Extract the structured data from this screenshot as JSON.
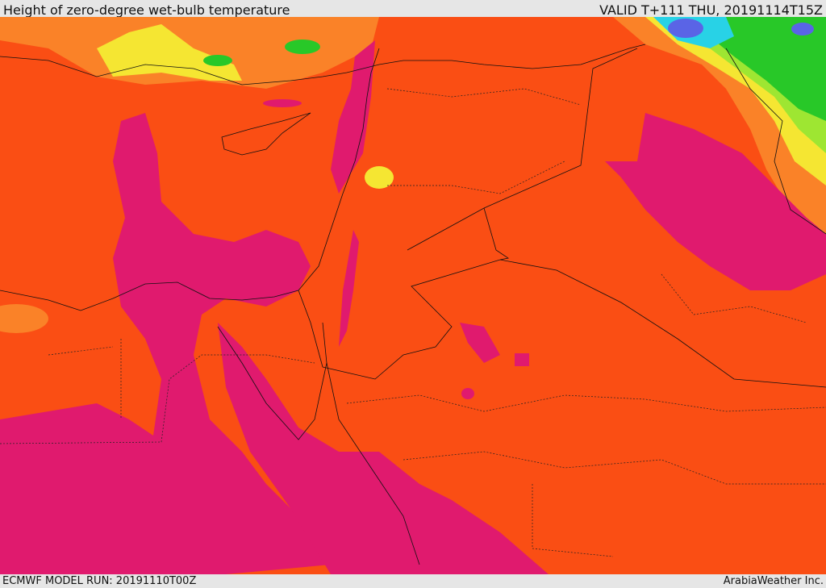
{
  "header": {
    "title": "Height of zero-degree wet-bulb temperature",
    "valid": "VALID T+111 THU, 20191114T15Z"
  },
  "footer": {
    "model_run": "ECMWF MODEL RUN: 20191110T00Z",
    "credit": "ArabiaWeather Inc."
  },
  "colors": {
    "base": "#fa4e14",
    "magenta": "#e01a6e",
    "orange": "#fa8228",
    "yellow": "#f5e632",
    "light_green": "#9ee632",
    "green": "#28c828",
    "cyan": "#28d2e6",
    "blue": "#5a64e6"
  }
}
